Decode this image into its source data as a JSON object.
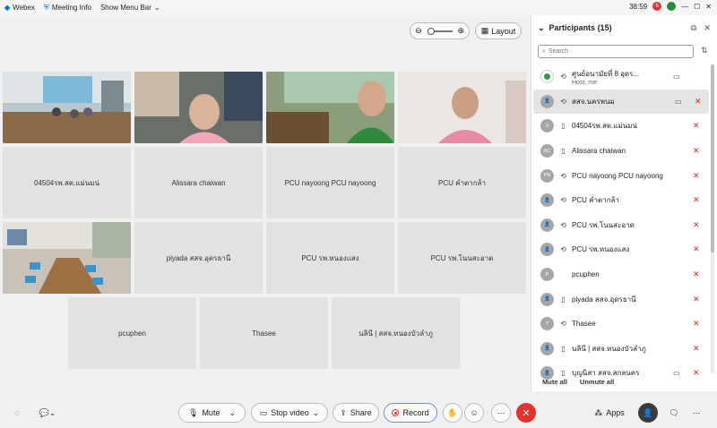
{
  "app": {
    "name": "Webex",
    "menu_meeting_info": "Meeting Info",
    "menu_show_bar": "Show Menu Bar",
    "timer": "38:59",
    "notif_count": "6"
  },
  "stage": {
    "layout_label": "Layout",
    "tiles": [
      {
        "kind": "video",
        "label": ""
      },
      {
        "kind": "video",
        "label": ""
      },
      {
        "kind": "video",
        "label": ""
      },
      {
        "kind": "video",
        "label": ""
      },
      {
        "kind": "name",
        "label": "04504รพ.สต.แม่นมน่"
      },
      {
        "kind": "name",
        "label": "Alissara chaiwan"
      },
      {
        "kind": "name",
        "label": "PCU nayoong PCU nayoong"
      },
      {
        "kind": "name",
        "label": "PCU คำตากล้า"
      },
      {
        "kind": "video",
        "label": ""
      },
      {
        "kind": "name",
        "label": "piyada สสจ.อุดรธานี"
      },
      {
        "kind": "name",
        "label": "PCU รพ.หนองแสง"
      },
      {
        "kind": "name",
        "label": "PCU รพ.โนนสะอาด"
      },
      {
        "kind": "name",
        "label": "pcuphen"
      },
      {
        "kind": "name",
        "label": "Thasee"
      },
      {
        "kind": "name",
        "label": "นลินี | สสจ.หนองบัวลำภู"
      }
    ]
  },
  "toolbar": {
    "mute": "Mute",
    "stop_video": "Stop video",
    "share": "Share",
    "record": "Record",
    "apps": "Apps"
  },
  "panel": {
    "title": "Participants (15)",
    "search_placeholder": "Search",
    "participants": [
      {
        "name": "ศูนย์อนามัยที่ 8 อุดร...",
        "sub": "Host, me",
        "avatar": "",
        "device": "web",
        "camera": true,
        "muted": false,
        "host": true
      },
      {
        "name": "สสจ.นครพนม",
        "sub": "",
        "avatar": "",
        "device": "web",
        "camera": true,
        "muted": true,
        "host": false
      },
      {
        "name": "04504รพ.สต.แม่นมน่",
        "sub": "",
        "avatar": "0",
        "device": "phone",
        "camera": false,
        "muted": true,
        "host": false
      },
      {
        "name": "Alissara chaiwan",
        "sub": "",
        "avatar": "AC",
        "device": "phone",
        "camera": false,
        "muted": true,
        "host": false
      },
      {
        "name": "PCU nayoong PCU nayoong",
        "sub": "",
        "avatar": "PN",
        "device": "web",
        "camera": false,
        "muted": true,
        "host": false
      },
      {
        "name": "PCU คำตากล้า",
        "sub": "",
        "avatar": "",
        "device": "web",
        "camera": false,
        "muted": true,
        "host": false
      },
      {
        "name": "PCU รพ.โนนสะอาด",
        "sub": "",
        "avatar": "",
        "device": "web",
        "camera": false,
        "muted": true,
        "host": false
      },
      {
        "name": "PCU รพ.หนองแสง",
        "sub": "",
        "avatar": "",
        "device": "web",
        "camera": false,
        "muted": true,
        "host": false
      },
      {
        "name": "pcuphen",
        "sub": "",
        "avatar": "P",
        "device": "",
        "camera": false,
        "muted": true,
        "host": false
      },
      {
        "name": "piyada สสจ.อุดรธานี",
        "sub": "",
        "avatar": "",
        "device": "phone",
        "camera": false,
        "muted": true,
        "host": false
      },
      {
        "name": "Thasee",
        "sub": "",
        "avatar": "T",
        "device": "web",
        "camera": false,
        "muted": true,
        "host": false
      },
      {
        "name": "นลินี | สสจ.หนองบัวลำภู",
        "sub": "",
        "avatar": "",
        "device": "phone",
        "camera": false,
        "muted": true,
        "host": false
      },
      {
        "name": "บุญนิสา สสจ.สกลนคร",
        "sub": "",
        "avatar": "",
        "device": "phone",
        "camera": true,
        "muted": true,
        "host": false
      }
    ],
    "mute_all": "Mute all",
    "unmute_all": "Unmute all"
  }
}
